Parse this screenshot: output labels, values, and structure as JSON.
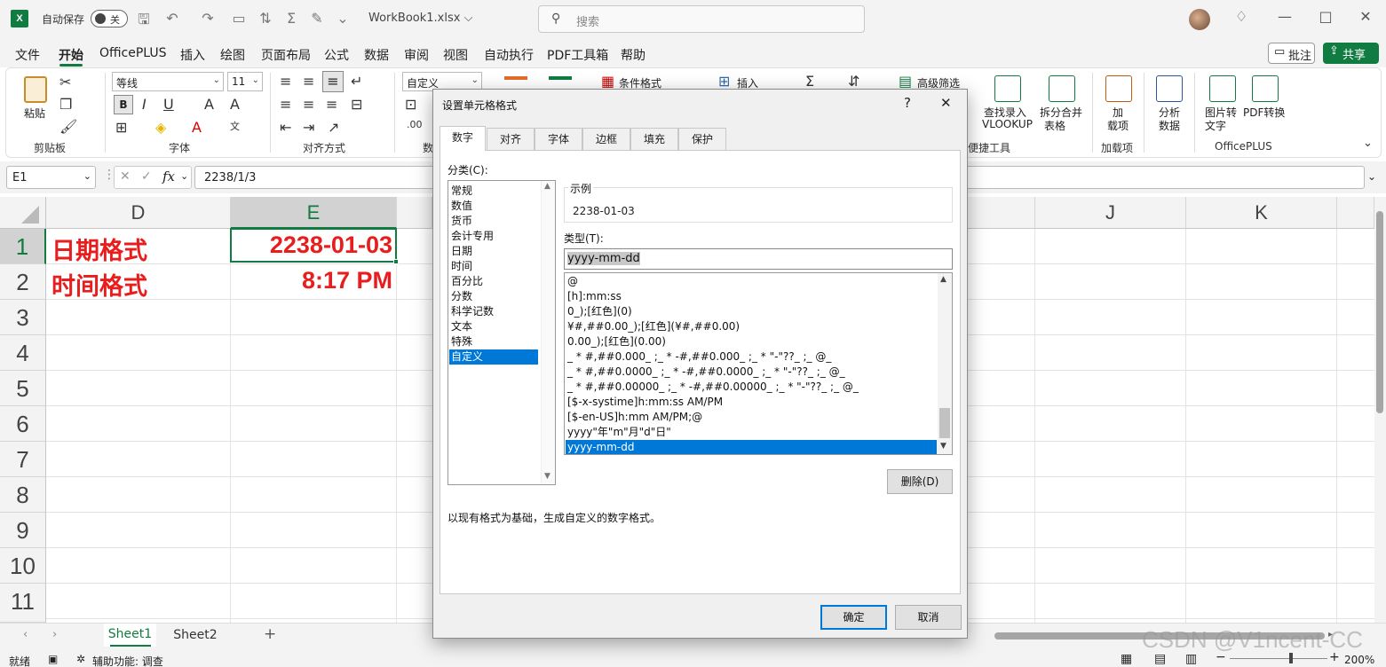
{
  "titlebar": {
    "autosave_label": "自动保存",
    "autosave_state": "关",
    "workbook_name": "WorkBook1.xlsx ⌵",
    "search_placeholder": "搜索"
  },
  "menu": {
    "file": "文件",
    "start": "开始",
    "officeplus": "OfficePLUS",
    "insert": "插入",
    "draw": "绘图",
    "page_layout": "页面布局",
    "formula": "公式",
    "data": "数据",
    "review": "审阅",
    "view": "视图",
    "automate": "自动执行",
    "pdf": "PDF工具箱",
    "help": "帮助",
    "comment": "批注",
    "share": "共享"
  },
  "ribbon": {
    "paste": "粘贴",
    "clipboard": "剪贴板",
    "font_name": "等线",
    "font_size": "11",
    "font_group": "字体",
    "align_group": "对齐方式",
    "number_format": "自定义",
    "number_group_partial": "数",
    "cond_format": "条件格式",
    "insert_cells": "插入",
    "advanced_filter": "高级筛选",
    "convenient_tools": "便捷工具",
    "lookup_line1": "查找录入",
    "lookup_line2": "VLOOKUP",
    "split_line1": "拆分合并",
    "split_line2": "表格",
    "addin_line1": "加",
    "addin_line2": "载项",
    "addin_group": "加载项",
    "analyze_line1": "分析",
    "analyze_line2": "数据",
    "img_line1": "图片转",
    "img_line2": "文字",
    "pdf_line1": "PDF转换",
    "officeplus_group": "OfficePLUS"
  },
  "formula_bar": {
    "cell_ref": "E1",
    "formula": "2238/1/3"
  },
  "grid": {
    "columns": [
      "D",
      "E",
      "J",
      "K"
    ],
    "rows": [
      "1",
      "2",
      "3",
      "4",
      "5",
      "6",
      "7",
      "8",
      "9",
      "10",
      "11"
    ],
    "cells": {
      "D1": "日期格式",
      "E1": "2238-01-03",
      "D2": "时间格式",
      "E2": "8:17 PM"
    }
  },
  "sheets": [
    "Sheet1",
    "Sheet2"
  ],
  "statusbar": {
    "ready": "就绪",
    "accessibility": "辅助功能: 调查",
    "zoom": "200%"
  },
  "dialog": {
    "title": "设置单元格格式",
    "help": "?",
    "tabs": [
      "数字",
      "对齐",
      "字体",
      "边框",
      "填充",
      "保护"
    ],
    "category_label": "分类(C):",
    "categories": [
      "常规",
      "数值",
      "货币",
      "会计专用",
      "日期",
      "时间",
      "百分比",
      "分数",
      "科学记数",
      "文本",
      "特殊",
      "自定义"
    ],
    "sample_label": "示例",
    "sample_value": "2238-01-03",
    "type_label": "类型(T):",
    "type_value": "yyyy-mm-dd",
    "formats": [
      "@",
      "[h]:mm:ss",
      "0_);[红色](0)",
      "¥#,##0.00_);[红色](¥#,##0.00)",
      "0.00_);[红色](0.00)",
      "_ * #,##0.000_ ;_ * -#,##0.000_ ;_ * \"-\"??_ ;_ @_",
      "_ * #,##0.0000_ ;_ * -#,##0.0000_ ;_ * \"-\"??_ ;_ @_",
      "_ * #,##0.00000_ ;_ * -#,##0.00000_ ;_ * \"-\"??_ ;_ @_",
      "[$-x-systime]h:mm:ss AM/PM",
      "[$-en-US]h:mm AM/PM;@",
      "yyyy\"年\"m\"月\"d\"日\"",
      "yyyy-mm-dd"
    ],
    "delete_button": "删除(D)",
    "description": "以现有格式为基础，生成自定义的数字格式。",
    "ok_button": "确定",
    "cancel_button": "取消"
  },
  "watermark": "CSDN @V1ncent-CC",
  "colors": {
    "excel_green": "#107c41",
    "cell_red": "#e81d1d",
    "selection_blue": "#0078d7"
  }
}
